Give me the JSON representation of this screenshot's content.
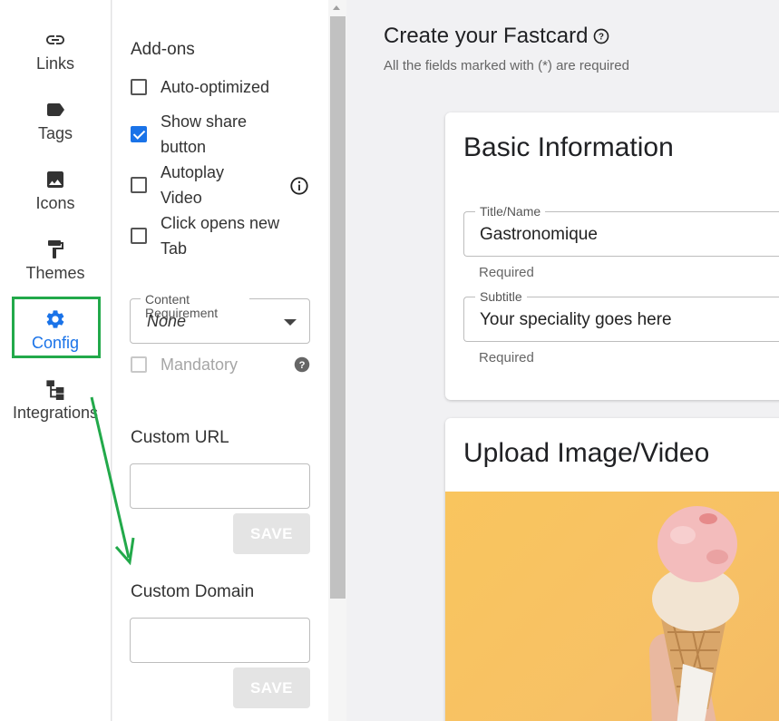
{
  "nav": {
    "items": [
      {
        "label": "Links",
        "icon": "link-icon"
      },
      {
        "label": "Tags",
        "icon": "tag-icon"
      },
      {
        "label": "Icons",
        "icon": "image-icon"
      },
      {
        "label": "Themes",
        "icon": "paint-roller-icon"
      },
      {
        "label": "Config",
        "icon": "gear-icon"
      },
      {
        "label": "Integrations",
        "icon": "integrations-icon"
      }
    ],
    "active_color": "#1a73e8",
    "highlight_color": "#22a94a"
  },
  "panel": {
    "addons_title": "Add-ons",
    "checkboxes": [
      {
        "label": "Auto-optimized",
        "checked": false
      },
      {
        "label": "Show share button",
        "checked": true
      },
      {
        "label": "Autoplay Video",
        "checked": false
      },
      {
        "label": "Click opens new Tab",
        "checked": false
      }
    ],
    "content_requirement": {
      "legend": "Content Requirement",
      "value": "None"
    },
    "mandatory": {
      "label": "Mandatory",
      "checked": false,
      "disabled": true
    },
    "custom_url": {
      "label": "Custom URL",
      "value": "",
      "save_label": "SAVE"
    },
    "custom_domain": {
      "label": "Custom Domain",
      "value": "",
      "save_label": "SAVE"
    }
  },
  "main": {
    "title": "Create your Fastcard",
    "subtitle": "All the fields marked with (*) are required",
    "basic_info": {
      "title": "Basic Information",
      "fields": [
        {
          "legend": "Title/Name",
          "value": "Gastronomique",
          "helper": "Required"
        },
        {
          "legend": "Subtitle",
          "value": "Your speciality goes here",
          "helper": "Required"
        }
      ]
    },
    "upload": {
      "title": "Upload Image/Video",
      "image": "ice-cream-cone-photo"
    }
  }
}
